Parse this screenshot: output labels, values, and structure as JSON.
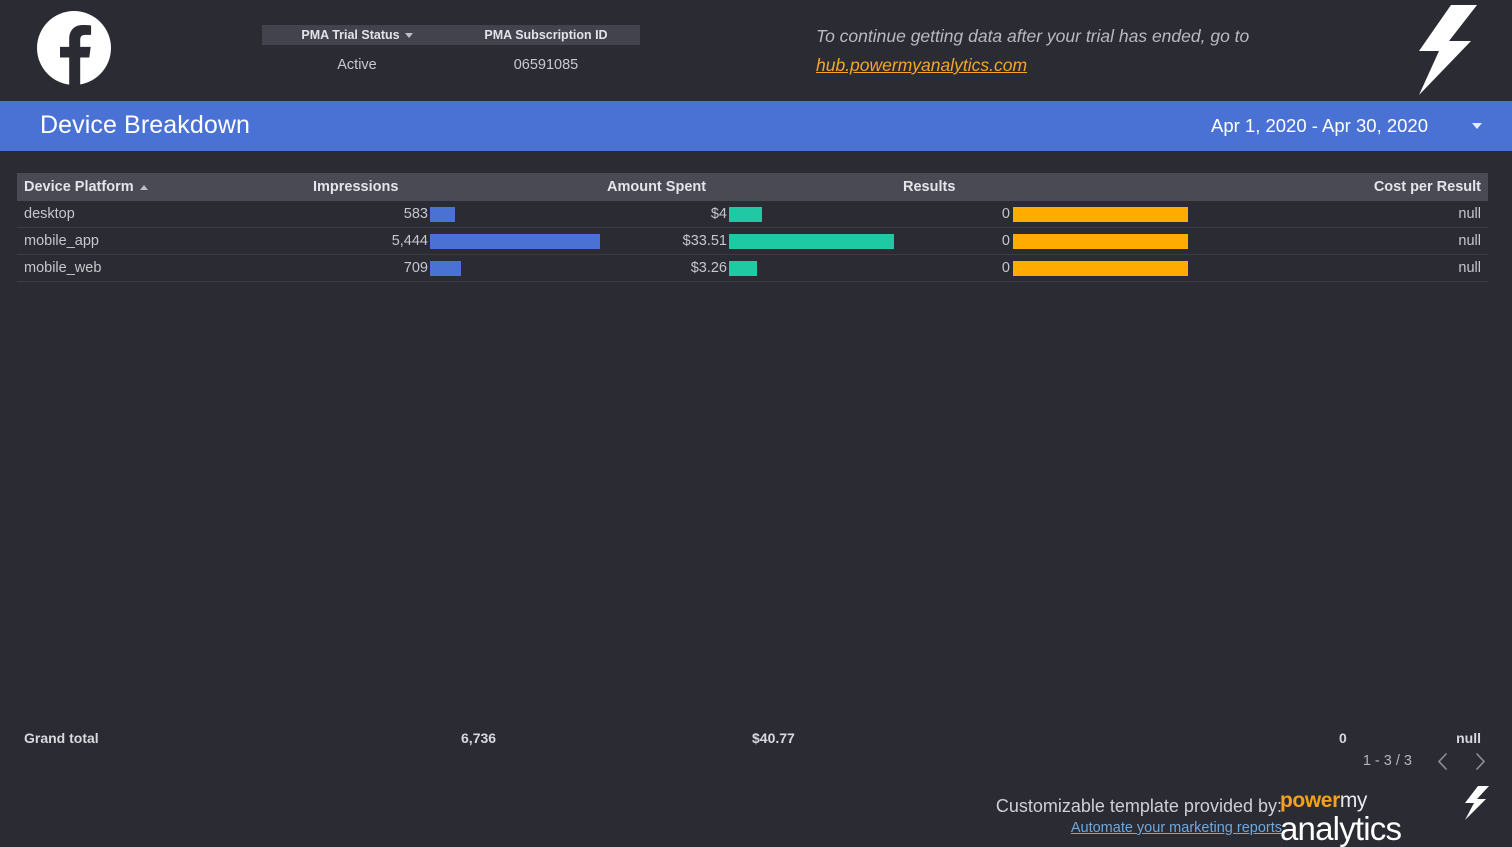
{
  "header": {
    "platform_logo": "facebook-logo",
    "brand_bolt": "lightning-bolt-icon",
    "scorecards": [
      {
        "label": "PMA Trial Status",
        "value": "Active",
        "has_dropdown": true
      },
      {
        "label": "PMA Subscription ID",
        "value": "06591085",
        "has_dropdown": false
      }
    ],
    "trial_note_text": "To continue getting data after your trial has ended, go to",
    "trial_note_link": "hub.powermyanalytics.com"
  },
  "title_bar": {
    "title": "Device Breakdown",
    "date_range": "Apr 1, 2020 - Apr 30, 2020",
    "background_color": "#4a72d4"
  },
  "table": {
    "columns": [
      {
        "label": "Device Platform",
        "align": "left",
        "sorted": true,
        "sort_dir": "asc"
      },
      {
        "label": "Impressions",
        "align": "left"
      },
      {
        "label": "Amount Spent",
        "align": "left"
      },
      {
        "label": "Results",
        "align": "left"
      },
      {
        "label": "Cost per Result",
        "align": "right"
      }
    ],
    "rows": [
      {
        "device_platform": "desktop",
        "impressions": "583",
        "impressions_pct": 10.7,
        "amount_spent": "$4",
        "amount_spent_pct": 14.5,
        "results": "0",
        "results_pct": 100,
        "cost_per_result": "null"
      },
      {
        "device_platform": "mobile_app",
        "impressions": "5,444",
        "impressions_pct": 100,
        "amount_spent": "$33.51",
        "amount_spent_pct": 100,
        "results": "0",
        "results_pct": 100,
        "cost_per_result": "null"
      },
      {
        "device_platform": "mobile_web",
        "impressions": "709",
        "impressions_pct": 13.0,
        "amount_spent": "$3.26",
        "amount_spent_pct": 12.5,
        "results": "0",
        "results_pct": 100,
        "cost_per_result": "null"
      }
    ],
    "total_row": {
      "label": "Grand total",
      "impressions": "6,736",
      "amount_spent": "$40.77",
      "results": "0",
      "cost_per_result": "null"
    },
    "bar_colors": {
      "impressions": "#4a72d4",
      "amount_spent": "#1ec9a3",
      "results": "#ffab00"
    }
  },
  "pagination": {
    "counter": "1 - 3 / 3",
    "prev_label": "previous-page",
    "next_label": "next-page"
  },
  "footer": {
    "caption": "Customizable template provided by:",
    "link": "Automate your marketing reports",
    "wordmark_power": "power",
    "wordmark_my": "my",
    "wordmark_analytics": "analytics"
  }
}
